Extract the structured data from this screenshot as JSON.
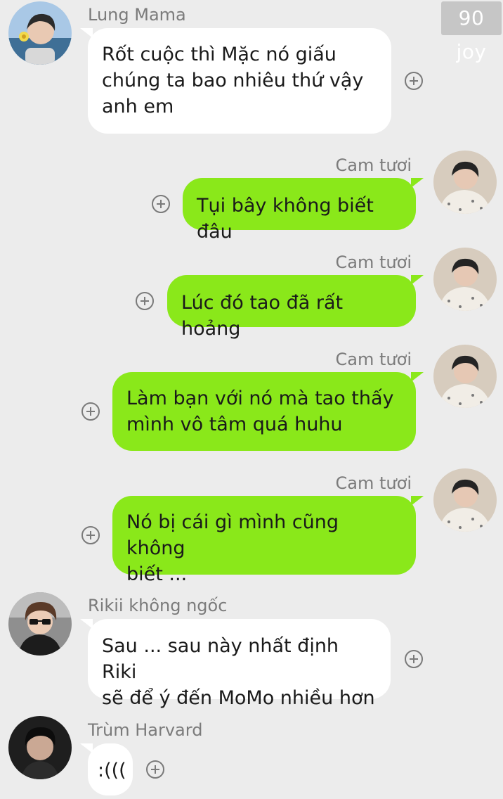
{
  "watermark": "90 joy",
  "messages": [
    {
      "sender": "Lung Mama",
      "side": "in",
      "avatar": "lung-mama-avatar",
      "text": "Rốt cuộc thì Mặc nó giấu\nchúng ta bao nhiêu thứ vậy\nanh em"
    },
    {
      "sender": "Cam tươi",
      "side": "out",
      "avatar": "cam-tuoi-avatar",
      "text": "Tụi bây không biết đâu"
    },
    {
      "sender": "Cam tươi",
      "side": "out",
      "avatar": "cam-tuoi-avatar",
      "text": "Lúc đó tao đã rất hoảng"
    },
    {
      "sender": "Cam tươi",
      "side": "out",
      "avatar": "cam-tuoi-avatar",
      "text": "Làm bạn với nó mà tao thấy\nmình vô tâm quá huhu"
    },
    {
      "sender": "Cam tươi",
      "side": "out",
      "avatar": "cam-tuoi-avatar",
      "text": "Nó bị cái gì mình cũng không\nbiết ..."
    },
    {
      "sender": "Rikii không ngốc",
      "side": "in",
      "avatar": "rikii-avatar",
      "text": "Sau ... sau này nhất định Riki\nsẽ để ý đến MoMo nhiều hơn"
    },
    {
      "sender": "Trùm Harvard",
      "side": "in",
      "avatar": "trum-harvard-avatar",
      "text": ":((("
    }
  ],
  "colors": {
    "background": "#ececec",
    "outgoing_bubble": "#8ae81a",
    "incoming_bubble": "#ffffff",
    "sender_name": "#7b7b7b"
  },
  "icons": {
    "add_reaction": "plus-circle-icon"
  }
}
